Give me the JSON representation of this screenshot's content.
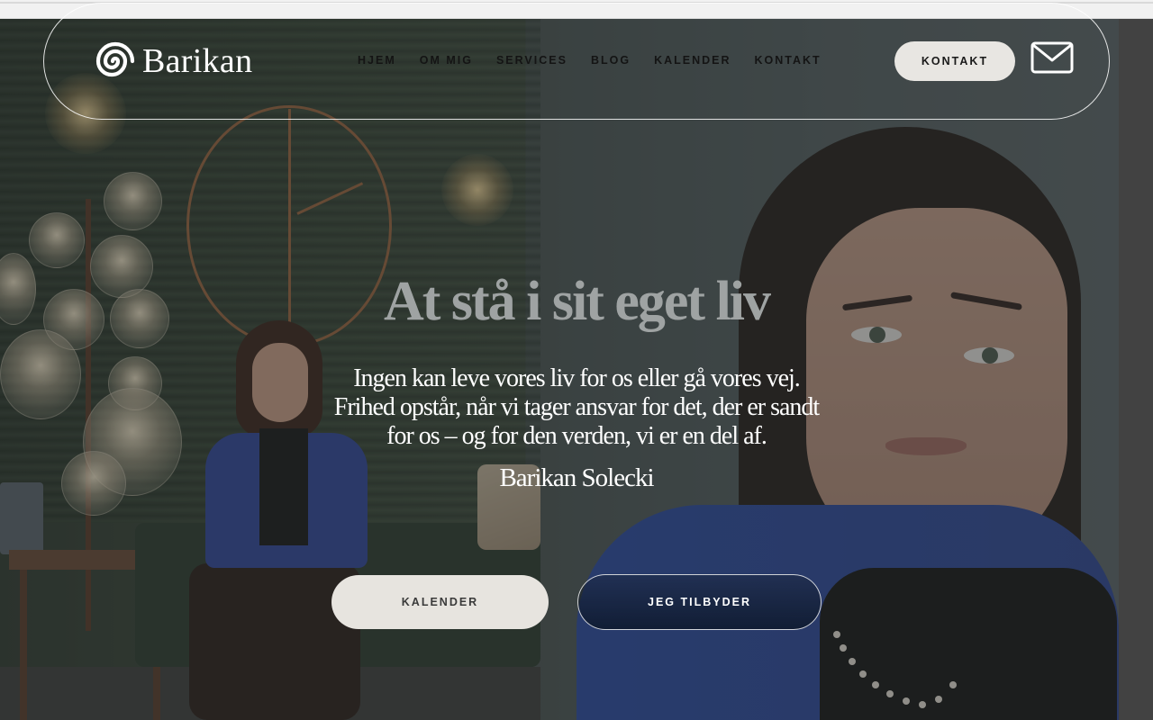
{
  "brand": {
    "name": "Barikan",
    "logo_icon": "spiral-logo-icon"
  },
  "nav": {
    "items": [
      {
        "label": "HJEM"
      },
      {
        "label": "OM MIG"
      },
      {
        "label": "SERVICES"
      },
      {
        "label": "BLOG"
      },
      {
        "label": "KALENDER"
      },
      {
        "label": "KONTAKT"
      }
    ],
    "contact_button": "KONTAKT",
    "mail_icon": "envelope-icon"
  },
  "hero": {
    "title": "At stå i sit eget liv",
    "quote_lines": [
      "Ingen kan leve vores liv for os eller gå vores vej.",
      "Frihed opstår, når vi tager ansvar for det, der er sandt",
      "for os – og for den verden, vi er en del af."
    ],
    "author": "Barikan Solecki",
    "primary_button": "KALENDER",
    "secondary_button": "JEG TILBYDER"
  },
  "colors": {
    "header_outline": "#ffffff",
    "button_light": "#e7e4df",
    "title_muted": "#9fa3a3"
  }
}
